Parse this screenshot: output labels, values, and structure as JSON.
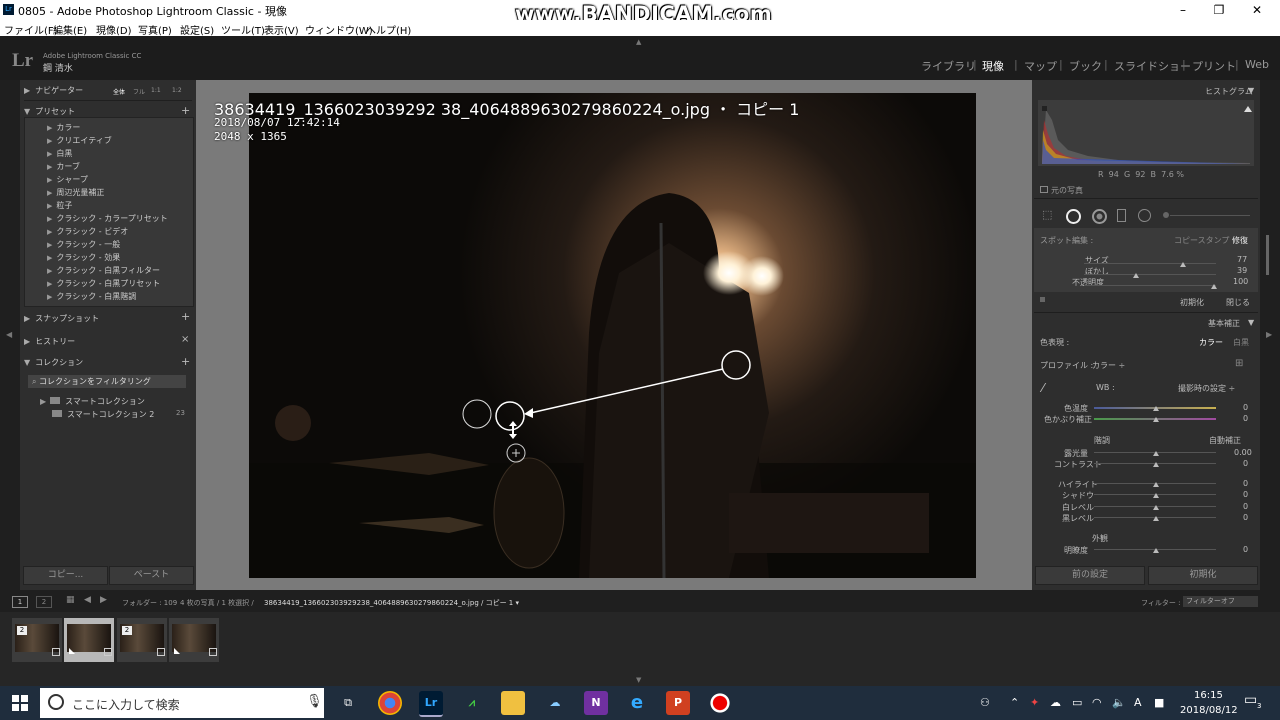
{
  "window": {
    "title": "0805 - Adobe Photoshop Lightroom Classic - 現像",
    "minimize": "–",
    "restore": "❐",
    "close": "✕"
  },
  "watermark": "www.BANDICAM.com",
  "menu": [
    "ファイル(F)",
    "編集(E)",
    "現像(D)",
    "写真(P)",
    "設定(S)",
    "ツール(T)",
    "表示(V)",
    "ウィンドウ(W)",
    "ヘルプ(H)"
  ],
  "identity": {
    "logo": "Lr",
    "product": "Adobe Lightroom Classic CC",
    "user": "鋼 清水"
  },
  "modules": [
    "ライブラリ",
    "現像",
    "マップ",
    "ブック",
    "スライドショー",
    "プリント",
    "Web"
  ],
  "module_separator": "|",
  "left_panel": {
    "navigator": {
      "label": "ナビゲーター",
      "zoom": [
        "全体",
        "フル",
        "1:1",
        "1:2"
      ]
    },
    "presets": {
      "label": "プリセット",
      "add": "+",
      "items": [
        "カラー",
        "クリエイティブ",
        "白黒",
        "カーブ",
        "シャープ",
        "周辺光量補正",
        "粒子",
        "クラシック - カラープリセット",
        "クラシック - ビデオ",
        "クラシック - 一般",
        "クラシック - 効果",
        "クラシック - 白黒フィルター",
        "クラシック - 白黒プリセット",
        "クラシック - 白黒階調"
      ]
    },
    "snapshots": {
      "label": "スナップショット",
      "add": "+"
    },
    "history": {
      "label": "ヒストリー",
      "clear": "×"
    },
    "collections": {
      "label": "コレクション",
      "add": "+",
      "filter": "コレクションをフィルタリング",
      "items": [
        {
          "label": "スマートコレクション",
          "count": ""
        },
        {
          "label": "スマートコレクション 2",
          "count": "23"
        }
      ]
    },
    "copy": "コピー...",
    "paste": "ペースト"
  },
  "photo": {
    "filename": "38634419_1366023039292 38_4064889630279860224_o.jpg ・ コピー 1",
    "datetime": "2018/08/07 12:42:14",
    "dimensions": "2048 x 1365"
  },
  "right_panel": {
    "histogram": {
      "label": "ヒストグラム",
      "readout_r": "R",
      "r": "94",
      "readout_g": "G",
      "g": "92",
      "readout_b": "B",
      "b": "7.6 %",
      "original": "元の写真"
    },
    "spot": {
      "label": "スポット編集 :",
      "clone": "コピースタンプ",
      "heal": "修復",
      "size_label": "サイズ",
      "size": "77",
      "feather_label": "ぼかし",
      "feather": "39",
      "opacity_label": "不透明度",
      "opacity": "100",
      "reset": "初期化",
      "close": "閉じる"
    },
    "basic": {
      "label": "基本補正",
      "treatment_label": "色表現 :",
      "color": "カラー",
      "bw": "白黒",
      "profile_label": "プロファイル :",
      "profile": "カラー ÷",
      "wb_label": "WB :",
      "wb": "撮影時の設定 ÷",
      "temp_label": "色温度",
      "temp": "0",
      "tint_label": "色かぶり補正",
      "tint": "0",
      "tone_label": "階調",
      "auto": "自動補正",
      "exposure_label": "露光量",
      "exposure": "0.00",
      "contrast_label": "コントラスト",
      "contrast": "0",
      "highlights_label": "ハイライト",
      "highlights": "0",
      "shadows_label": "シャドウ",
      "shadows": "0",
      "whites_label": "白レベル",
      "whites": "0",
      "blacks_label": "黒レベル",
      "blacks": "0",
      "presence_label": "外観",
      "clarity_label": "明瞭度",
      "clarity": "0"
    },
    "prev": "前の設定",
    "reset": "初期化"
  },
  "filmstrip_bar": {
    "view1": "1",
    "view2": "2",
    "source": "フォルダー : 109",
    "selection": "4 枚の写真 / 1 枚選択 /",
    "current": "38634419_136602303929238_4064889630279860224_o.jpg / コピー 1 ▾",
    "filter_label": "フィルター :",
    "filter": "フィルターオフ"
  },
  "thumb_badges": [
    "2",
    "",
    "2",
    ""
  ],
  "taskbar": {
    "search_placeholder": "ここに入力して検索",
    "time": "16:15",
    "date": "2018/08/12",
    "notifications": "3",
    "ime": "A"
  }
}
